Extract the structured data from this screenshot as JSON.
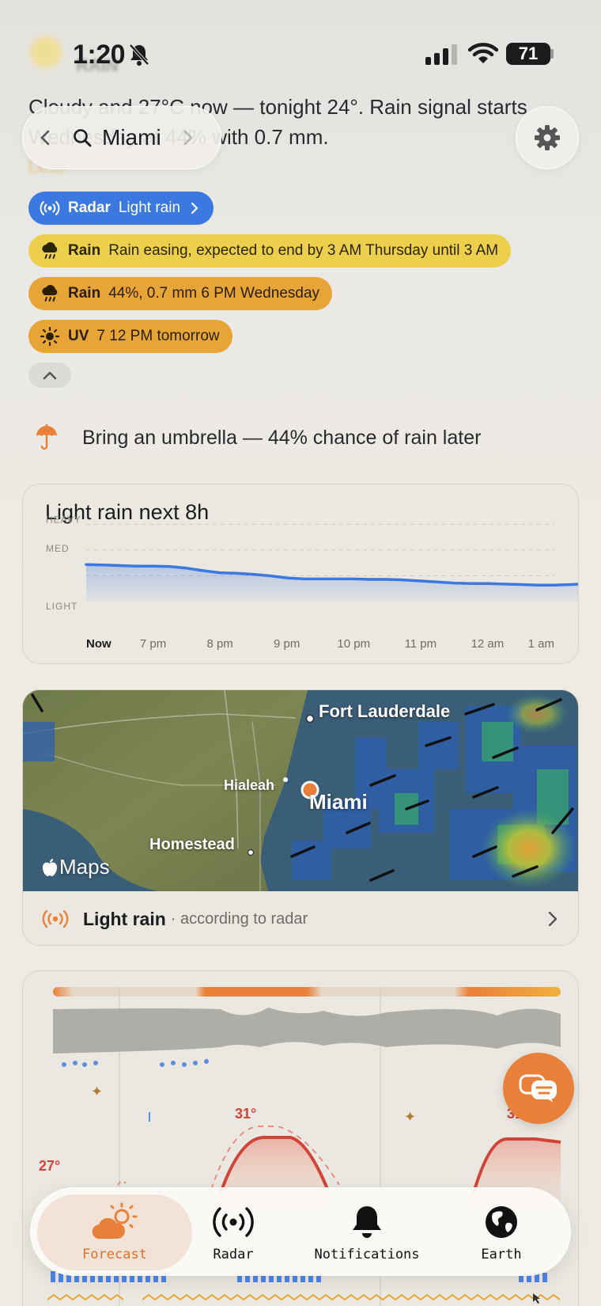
{
  "status_bar": {
    "time": "1:20",
    "battery": "71"
  },
  "header": {
    "ghost_title": "RAIN",
    "summary_text": "Cloudy and 27°C now — tonight 24°. Rain signal starts Wednesday at 44% with 0.7 mm.",
    "ghost_less": "Less"
  },
  "search": {
    "city": "Miami"
  },
  "chips": {
    "radar": {
      "label": "Radar",
      "value": "Light rain"
    },
    "rain_easing": {
      "label": "Rain",
      "value": "Rain easing, expected to end by 3 AM Thursday until 3 AM"
    },
    "rain_chance": {
      "label": "Rain",
      "value": "44%, 0.7 mm 6 PM Wednesday"
    },
    "uv": {
      "label": "UV",
      "value": "7 12 PM tomorrow"
    }
  },
  "advice": {
    "text": "Bring an umbrella — 44% chance of rain later"
  },
  "rain_card": {
    "title": "Light rain next 8h",
    "chart_data": {
      "type": "area",
      "title": "Light rain next 8h",
      "y_levels": [
        "HEAVY",
        "MED",
        "LIGHT"
      ],
      "x_labels": [
        "Now",
        "7 pm",
        "8 pm",
        "9 pm",
        "10 pm",
        "11 pm",
        "12 am",
        "1 am"
      ],
      "series": [
        {
          "x": [
            0,
            0.25,
            0.5,
            0.75,
            1,
            1.25,
            1.5,
            1.75,
            2,
            2.25,
            2.5,
            2.75,
            3,
            3.25,
            3.5,
            3.75,
            4,
            4.25,
            4.5,
            4.75,
            5,
            5.25,
            5.5,
            5.75,
            6,
            6.25,
            6.5,
            6.75,
            7,
            7.25,
            7.5,
            7.75,
            8
          ],
          "values": [
            0.72,
            0.71,
            0.7,
            0.69,
            0.69,
            0.68,
            0.65,
            0.6,
            0.56,
            0.55,
            0.53,
            0.5,
            0.46,
            0.44,
            0.44,
            0.44,
            0.44,
            0.43,
            0.43,
            0.42,
            0.4,
            0.38,
            0.36,
            0.35,
            0.35,
            0.34,
            0.33,
            0.32,
            0.32,
            0.33,
            0.35,
            0.38,
            0.4
          ]
        }
      ],
      "ylim": [
        0,
        1.6
      ],
      "color": "#3b78e0"
    }
  },
  "map": {
    "labels": {
      "fort_lauderdale": "Fort Lauderdale",
      "hialeah": "Hialeah",
      "miami": "Miami",
      "homestead": "Homestead",
      "attribution": "Maps"
    },
    "footer_label": "Light rain",
    "footer_sub": "· according to radar"
  },
  "forecast": {
    "temp_high_1": "31°",
    "temp_high_2": "31°",
    "temp_low": "27°"
  },
  "tabs": [
    {
      "label": "Forecast",
      "icon": "partly-cloudy-icon",
      "active": true
    },
    {
      "label": "Radar",
      "icon": "radar-icon",
      "active": false
    },
    {
      "label": "Notifications",
      "icon": "bell-icon",
      "active": false
    },
    {
      "label": "Earth",
      "icon": "globe-icon",
      "active": false
    }
  ],
  "colors": {
    "accent": "#e8803a",
    "radar_blue": "#3b78e0",
    "rain_yellow": "#eccf4c",
    "rain_orange": "#e6a536"
  }
}
